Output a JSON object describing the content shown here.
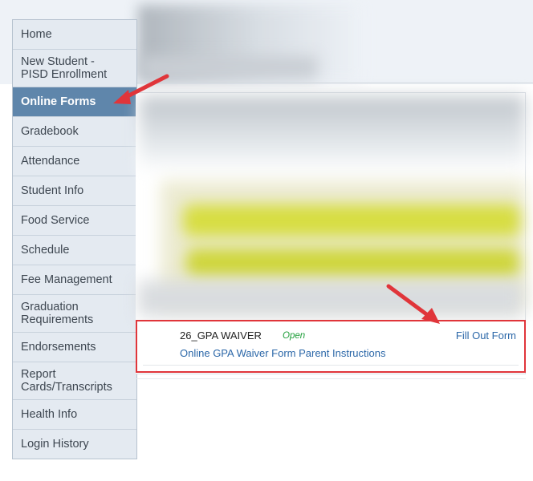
{
  "sidebar": {
    "items": [
      {
        "label": "Home"
      },
      {
        "label": "New Student -\nPISD Enrollment"
      },
      {
        "label": "Online Forms"
      },
      {
        "label": "Gradebook"
      },
      {
        "label": "Attendance"
      },
      {
        "label": "Student Info"
      },
      {
        "label": "Food Service"
      },
      {
        "label": "Schedule"
      },
      {
        "label": "Fee Management"
      },
      {
        "label": "Graduation\nRequirements"
      },
      {
        "label": "Endorsements"
      },
      {
        "label": "Report\nCards/Transcripts"
      },
      {
        "label": "Health Info"
      },
      {
        "label": "Login History"
      }
    ],
    "active_index": 2
  },
  "form": {
    "name": "26_GPA WAIVER",
    "status": "Open",
    "action_label": "Fill Out Form",
    "instructions_link": "Online GPA Waiver Form Parent Instructions"
  },
  "colors": {
    "sidebar_bg": "#e4eaf1",
    "active_bg": "#5f86ab",
    "link": "#2b67a8",
    "status_open": "#1f9e3a",
    "annotation_red": "#e0353a"
  }
}
